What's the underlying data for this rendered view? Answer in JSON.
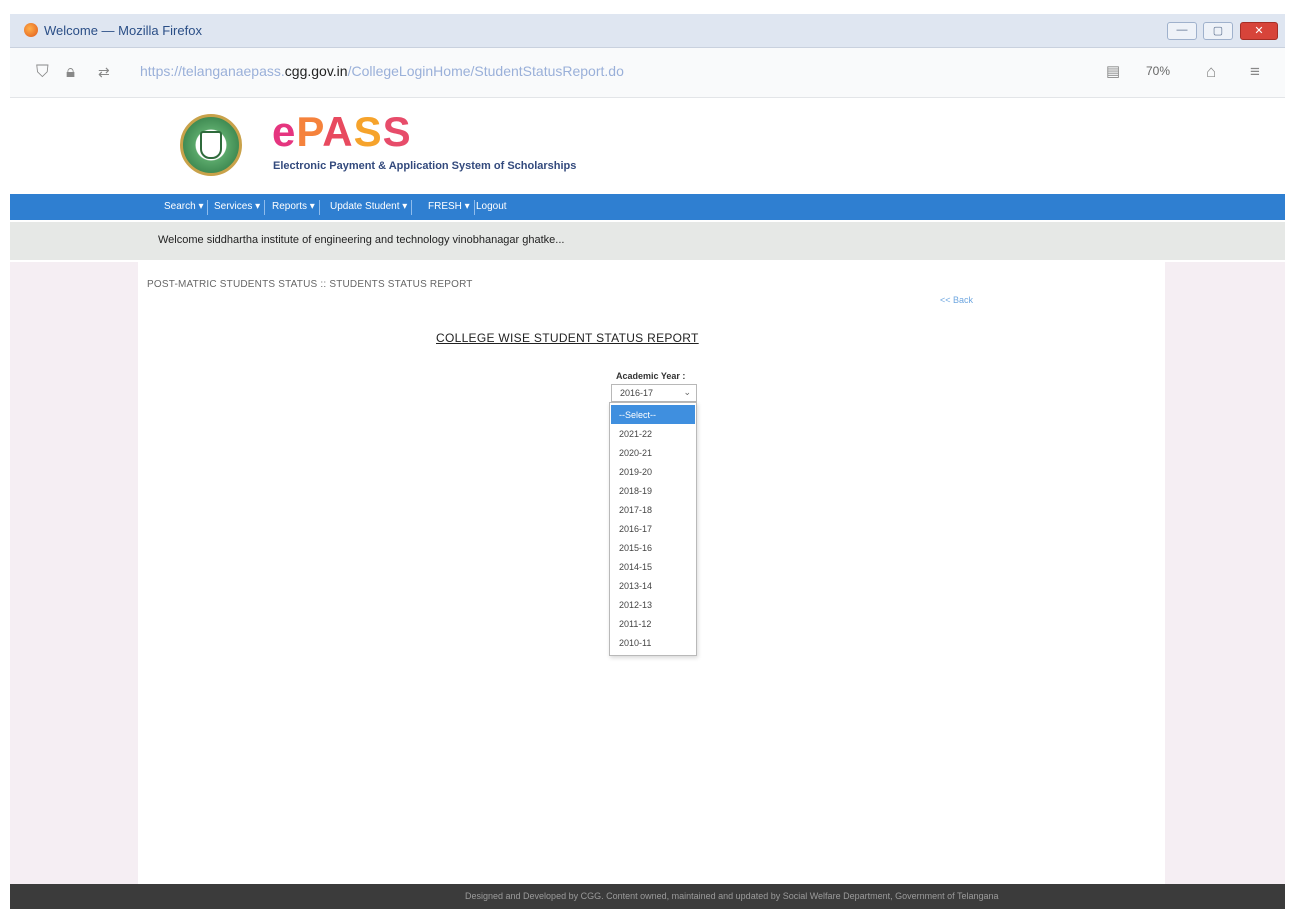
{
  "window": {
    "title": "Welcome — Mozilla Firefox"
  },
  "browser": {
    "url_prefix": "https://telanganaepass.",
    "url_domain": "cgg.gov.in",
    "url_suffix": "/CollegeLoginHome/StudentStatusReport.do",
    "zoom": "70%"
  },
  "header": {
    "logo": {
      "e": "e",
      "p": "P",
      "a": "A",
      "s1": "S",
      "s2": "S"
    },
    "tagline": "Electronic Payment & Application System of Scholarships"
  },
  "menu": {
    "items": [
      "Search ▾",
      "Services ▾",
      "Reports ▾",
      "Update Student ▾",
      "FRESH ▾",
      "Logout"
    ]
  },
  "welcome": {
    "text": "Welcome  siddhartha institute of engineering and technology vinobhanagar ghatke..."
  },
  "breadcrumb": "POST-MATRIC STUDENTS STATUS :: STUDENTS STATUS REPORT",
  "back_link": "<< Back",
  "report_title": "COLLEGE WISE STUDENT STATUS REPORT",
  "academic_year": {
    "label": "Academic Year :",
    "selected": "2016-17",
    "options": [
      "--Select--",
      "2021-22",
      "2020-21",
      "2019-20",
      "2018-19",
      "2017-18",
      "2016-17",
      "2015-16",
      "2014-15",
      "2013-14",
      "2012-13",
      "2011-12",
      "2010-11"
    ],
    "highlighted_index": 0
  },
  "footer": {
    "text": "Designed and Developed by CGG. Content owned, maintained and updated by Social Welfare Department, Government of Telangana"
  },
  "colors": {
    "menubar": "#2f7fd1",
    "highlight": "#3f8fdf",
    "footer": "#3b3b3b"
  }
}
